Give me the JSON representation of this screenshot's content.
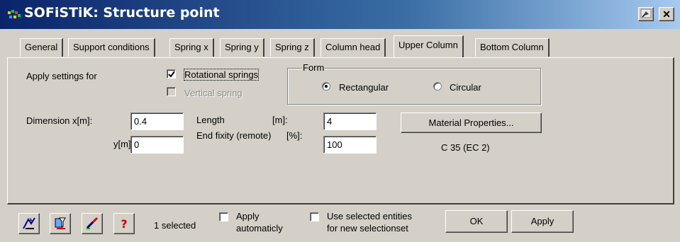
{
  "window": {
    "title": "SOFiSTiK: Structure point",
    "close_glyph": "✕",
    "colors": {
      "titlebar_start": "#0a246a",
      "titlebar_end": "#a6caf0",
      "face": "#d4d0c8"
    }
  },
  "tabs": [
    {
      "label": "General"
    },
    {
      "label": "Support conditions"
    },
    {
      "label": "Spring x"
    },
    {
      "label": "Spring y"
    },
    {
      "label": "Spring z"
    },
    {
      "label": "Column head"
    },
    {
      "label": "Upper Column",
      "active": true
    },
    {
      "label": "Bottom Column"
    }
  ],
  "settings": {
    "apply_label": "Apply settings for",
    "rotational_springs": {
      "label": "Rotational springs",
      "checked": true
    },
    "vertical_spring": {
      "label": "Vertical spring",
      "checked": false,
      "disabled": true
    }
  },
  "form": {
    "legend": "Form",
    "options": [
      {
        "label": "Rectangular",
        "selected": true
      },
      {
        "label": "Circular",
        "selected": false
      }
    ]
  },
  "dimension": {
    "x_label": "Dimension x[m]:",
    "x_value": "0.4",
    "y_label": "y[m]",
    "y_value": "0"
  },
  "column": {
    "length_label": "Length",
    "length_unit": "[m]:",
    "length_value": "4",
    "fixity_label": "End fixity (remote)",
    "fixity_unit": "[%]:",
    "fixity_value": "100"
  },
  "material": {
    "button_label": "Material Properties...",
    "value": "C 35 (EC 2)"
  },
  "footer": {
    "icons": [
      "select-tool-icon",
      "filter-tool-icon",
      "brush-tool-icon",
      "help-icon"
    ],
    "help_glyph": "?",
    "selected_text": "1  selected",
    "apply_auto": {
      "line1": "Apply",
      "line2": "automaticly",
      "checked": false
    },
    "use_selected": {
      "line1": "Use selected entities",
      "line2": "for new selectionset",
      "checked": false
    },
    "ok_label": "OK",
    "apply_label": "Apply"
  }
}
